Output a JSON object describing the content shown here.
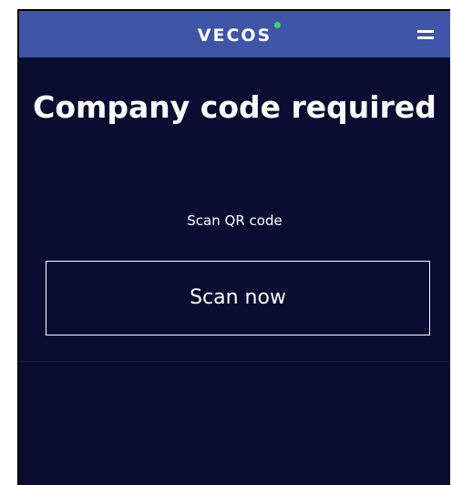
{
  "header": {
    "logo_text": "VECOS",
    "logo_dot_color": "#3fcf7a",
    "menu_icon": "hamburger-menu-icon",
    "background_color": "#3e55a8"
  },
  "main": {
    "title": "Company code required",
    "subtitle": "Scan QR code",
    "scan_button_label": "Scan now",
    "background_color": "#0a0c32"
  }
}
